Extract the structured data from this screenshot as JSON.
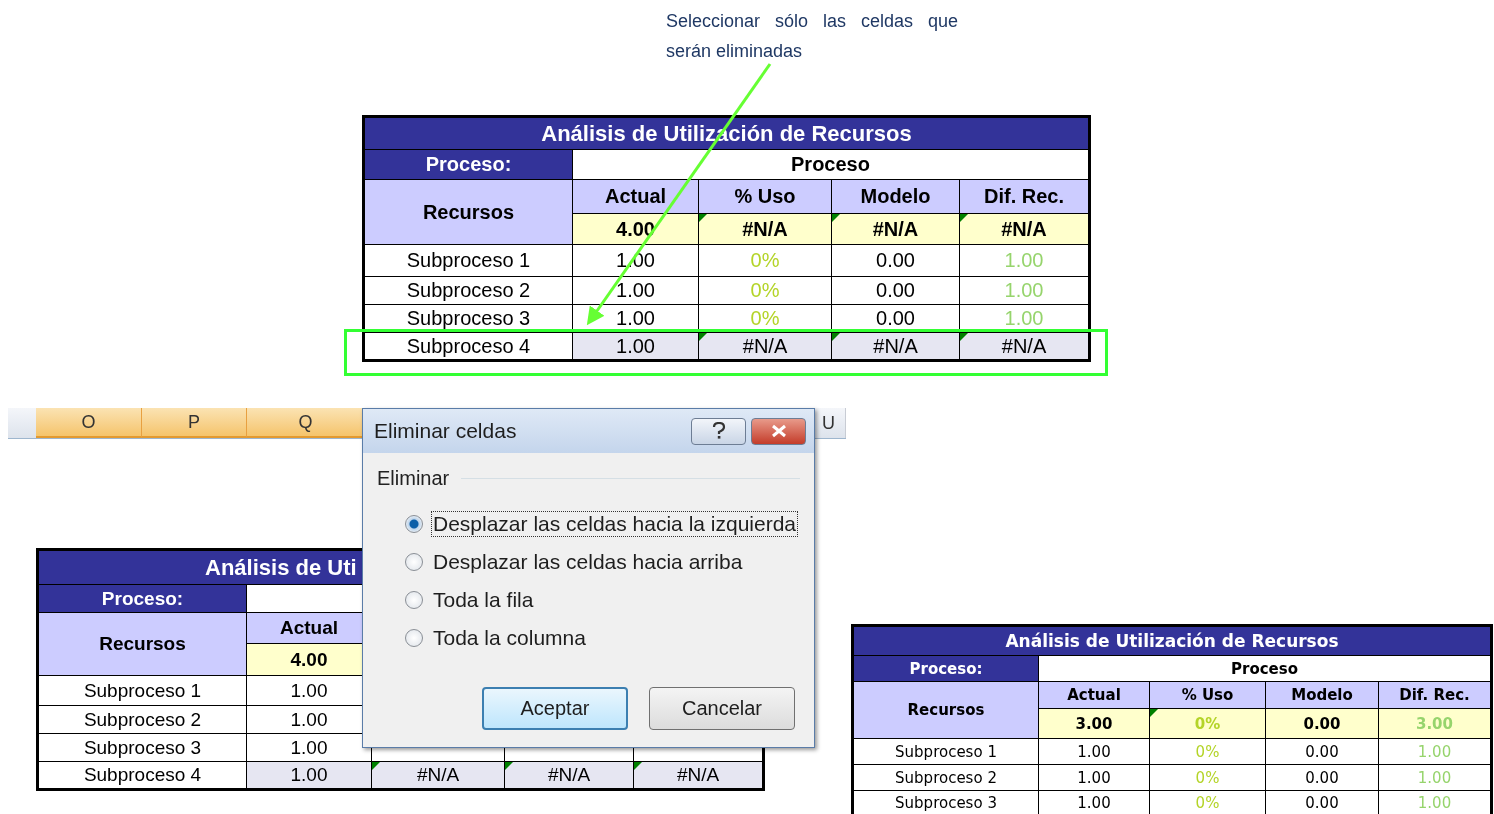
{
  "callout": {
    "text": "Seleccionar sólo las celdas que serán eliminadas"
  },
  "tables": [
    {
      "title": "Análisis de Utilización de Recursos",
      "proceso_label": "Proceso:",
      "proceso_value": "Proceso",
      "recursos_label": "Recursos",
      "columns": [
        "Actual",
        "% Uso",
        "Modelo",
        "Dif. Rec."
      ],
      "totals": [
        {
          "text": "4.00",
          "kind": "plain",
          "flagged": false
        },
        {
          "text": "#N/A",
          "kind": "plain",
          "flagged": true
        },
        {
          "text": "#N/A",
          "kind": "plain",
          "flagged": true
        },
        {
          "text": "#N/A",
          "kind": "plain",
          "flagged": true
        }
      ],
      "rows": [
        {
          "name": "Subproceso 1",
          "selected": false,
          "cells": [
            {
              "text": "1.00",
              "kind": "plain",
              "flagged": false
            },
            {
              "text": "0%",
              "kind": "percent",
              "flagged": false
            },
            {
              "text": "0.00",
              "kind": "plain",
              "flagged": false
            },
            {
              "text": "1.00",
              "kind": "difference",
              "flagged": false
            }
          ]
        },
        {
          "name": "Subproceso 2",
          "selected": false,
          "cells": [
            {
              "text": "1.00",
              "kind": "plain",
              "flagged": false
            },
            {
              "text": "0%",
              "kind": "percent",
              "flagged": false
            },
            {
              "text": "0.00",
              "kind": "plain",
              "flagged": false
            },
            {
              "text": "1.00",
              "kind": "difference",
              "flagged": false
            }
          ]
        },
        {
          "name": "Subproceso 3",
          "selected": false,
          "cells": [
            {
              "text": "1.00",
              "kind": "plain",
              "flagged": false
            },
            {
              "text": "0%",
              "kind": "percent",
              "flagged": false
            },
            {
              "text": "0.00",
              "kind": "plain",
              "flagged": false
            },
            {
              "text": "1.00",
              "kind": "difference",
              "flagged": false
            }
          ]
        },
        {
          "name": "Subproceso 4",
          "selected": true,
          "cells": [
            {
              "text": "1.00",
              "kind": "plain",
              "flagged": false
            },
            {
              "text": "#N/A",
              "kind": "plain",
              "flagged": true
            },
            {
              "text": "#N/A",
              "kind": "plain",
              "flagged": true
            },
            {
              "text": "#N/A",
              "kind": "plain",
              "flagged": true
            }
          ]
        }
      ]
    },
    {
      "title": "Análisis de Uti",
      "proceso_label": "Proceso:",
      "recursos_label": "Recursos",
      "columns": [
        "Actual"
      ],
      "totals": [
        {
          "text": "4.00",
          "kind": "plain",
          "flagged": false
        }
      ],
      "rows": [
        {
          "name": "Subproceso 1",
          "selected": false,
          "cells": [
            {
              "text": "1.00",
              "kind": "plain",
              "flagged": false
            }
          ]
        },
        {
          "name": "Subproceso 2",
          "selected": false,
          "cells": [
            {
              "text": "1.00",
              "kind": "plain",
              "flagged": false
            }
          ]
        },
        {
          "name": "Subproceso 3",
          "selected": false,
          "cells": [
            {
              "text": "1.00",
              "kind": "plain",
              "flagged": false
            }
          ]
        },
        {
          "name": "Subproceso 4",
          "selected": true,
          "cells": [
            {
              "text": "1.00",
              "kind": "plain",
              "flagged": false
            },
            {
              "text": "#N/A",
              "kind": "plain",
              "flagged": true
            },
            {
              "text": "#N/A",
              "kind": "plain",
              "flagged": true
            },
            {
              "text": "#N/A",
              "kind": "plain",
              "flagged": true
            }
          ]
        }
      ]
    },
    {
      "title": "Análisis de Utilización de Recursos",
      "proceso_label": "Proceso:",
      "proceso_value": "Proceso",
      "recursos_label": "Recursos",
      "columns": [
        "Actual",
        "% Uso",
        "Modelo",
        "Dif. Rec."
      ],
      "totals": [
        {
          "text": "3.00",
          "kind": "plain",
          "flagged": false
        },
        {
          "text": "0%",
          "kind": "percent",
          "flagged": true
        },
        {
          "text": "0.00",
          "kind": "plain",
          "flagged": false
        },
        {
          "text": "3.00",
          "kind": "difference",
          "flagged": false
        }
      ],
      "rows": [
        {
          "name": "Subproceso 1",
          "selected": false,
          "cells": [
            {
              "text": "1.00",
              "kind": "plain",
              "flagged": false
            },
            {
              "text": "0%",
              "kind": "percent",
              "flagged": false
            },
            {
              "text": "0.00",
              "kind": "plain",
              "flagged": false
            },
            {
              "text": "1.00",
              "kind": "difference",
              "flagged": false
            }
          ]
        },
        {
          "name": "Subproceso 2",
          "selected": false,
          "cells": [
            {
              "text": "1.00",
              "kind": "plain",
              "flagged": false
            },
            {
              "text": "0%",
              "kind": "percent",
              "flagged": false
            },
            {
              "text": "0.00",
              "kind": "plain",
              "flagged": false
            },
            {
              "text": "1.00",
              "kind": "difference",
              "flagged": false
            }
          ]
        },
        {
          "name": "Subproceso 3",
          "selected": false,
          "cells": [
            {
              "text": "1.00",
              "kind": "plain",
              "flagged": false
            },
            {
              "text": "0%",
              "kind": "percent",
              "flagged": false
            },
            {
              "text": "0.00",
              "kind": "plain",
              "flagged": false
            },
            {
              "text": "1.00",
              "kind": "difference",
              "flagged": false
            }
          ]
        }
      ]
    }
  ],
  "column_headers": [
    {
      "label": "O",
      "selected": true
    },
    {
      "label": "P",
      "selected": true
    },
    {
      "label": "Q",
      "selected": true
    },
    {
      "label": "U",
      "selected": false
    }
  ],
  "dialog": {
    "title": "Eliminar celdas",
    "group_label": "Eliminar",
    "options": [
      {
        "label": "Desplazar las celdas hacia la izquierda",
        "selected": true
      },
      {
        "label": "Desplazar las celdas hacia arriba",
        "selected": false
      },
      {
        "label": "Toda la fila",
        "selected": false
      },
      {
        "label": "Toda la columna",
        "selected": false
      }
    ],
    "buttons": [
      {
        "label": "Aceptar",
        "default": true
      },
      {
        "label": "Cancelar",
        "default": false
      }
    ]
  }
}
